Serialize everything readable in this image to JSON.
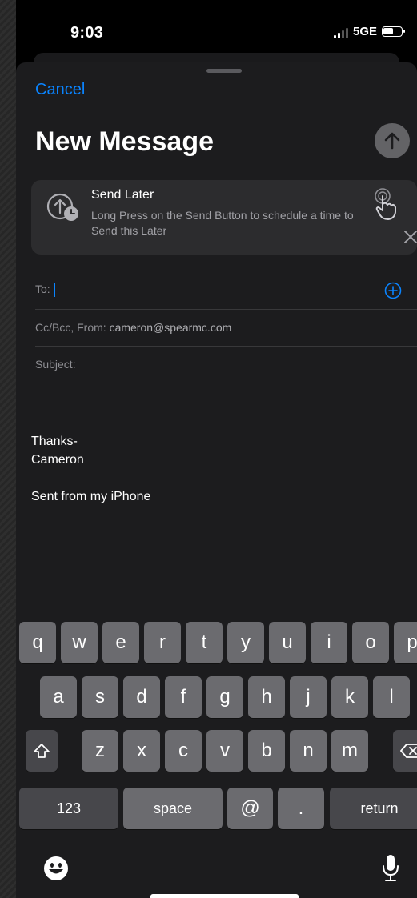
{
  "status": {
    "time": "9:03",
    "network": "5GE"
  },
  "compose": {
    "cancel_label": "Cancel",
    "title": "New Message",
    "banner": {
      "title": "Send Later",
      "description": "Long Press on the Send Button to schedule a time to Send this Later"
    },
    "to_label": "To:",
    "ccbcc_label": "Cc/Bcc, From:",
    "from_value": "cameron@spearmc.com",
    "subject_label": "Subject:",
    "body": {
      "line1": "Thanks-",
      "line2": "Cameron",
      "signature": "Sent from my iPhone"
    }
  },
  "keyboard": {
    "row1": [
      "q",
      "w",
      "e",
      "r",
      "t",
      "y",
      "u",
      "i",
      "o",
      "p"
    ],
    "row2": [
      "a",
      "s",
      "d",
      "f",
      "g",
      "h",
      "j",
      "k",
      "l"
    ],
    "row3": [
      "z",
      "x",
      "c",
      "v",
      "b",
      "n",
      "m"
    ],
    "numbers_label": "123",
    "space_label": "space",
    "at_label": "@",
    "period_label": ".",
    "return_label": "return"
  },
  "colors": {
    "accent": "#0a84ff",
    "sheet": "#1c1c1e",
    "banner": "#2c2c2e",
    "key": "#6b6b6f"
  }
}
